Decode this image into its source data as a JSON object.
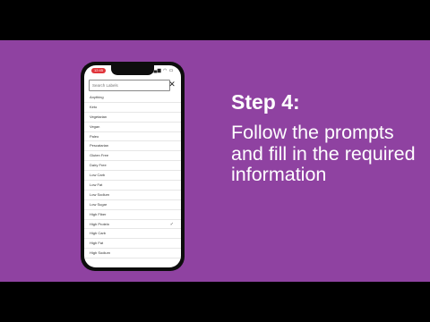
{
  "phone": {
    "status_time": "12:45",
    "status_icons": "▂▄▆ ◠ ▭",
    "search_placeholder": "Search Labels",
    "close_glyph": "✕",
    "check_glyph": "✓",
    "items": [
      {
        "label": "Anything",
        "checked": false
      },
      {
        "label": "Keto",
        "checked": false
      },
      {
        "label": "Vegetarian",
        "checked": false
      },
      {
        "label": "Vegan",
        "checked": false
      },
      {
        "label": "Paleo",
        "checked": false
      },
      {
        "label": "Pescatarian",
        "checked": false
      },
      {
        "label": "Gluten Free",
        "checked": false
      },
      {
        "label": "Dairy Free",
        "checked": false
      },
      {
        "label": "Low Carb",
        "checked": false
      },
      {
        "label": "Low Fat",
        "checked": false
      },
      {
        "label": "Low Sodium",
        "checked": false
      },
      {
        "label": "Low Sugar",
        "checked": false
      },
      {
        "label": "High Fiber",
        "checked": false
      },
      {
        "label": "High Protein",
        "checked": true
      },
      {
        "label": "High Carb",
        "checked": false
      },
      {
        "label": "High Fat",
        "checked": false
      },
      {
        "label": "High Sodium",
        "checked": false
      }
    ]
  },
  "slide": {
    "heading": "Step 4:",
    "body": "Follow the prompts and fill in the required information"
  },
  "colors": {
    "background": "#8f42a1",
    "accent": "#e0343a"
  }
}
